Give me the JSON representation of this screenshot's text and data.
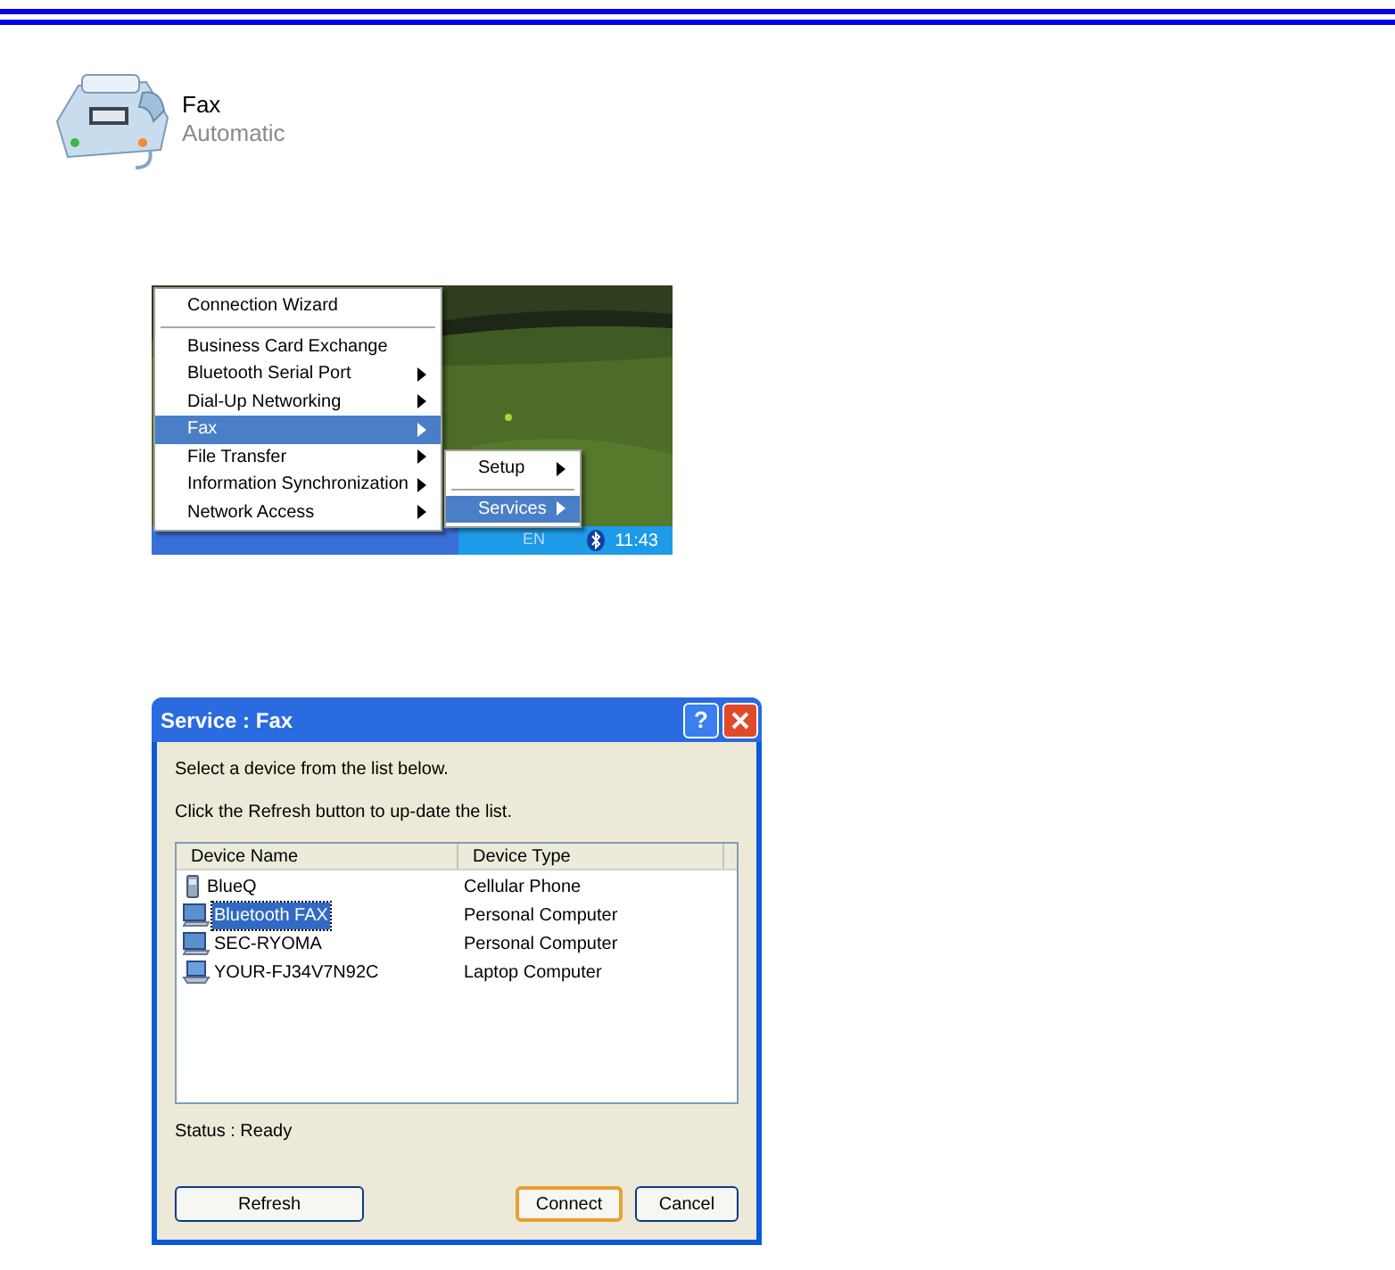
{
  "header": {
    "title": "Fax",
    "subtitle": "Automatic"
  },
  "menu": {
    "items": [
      {
        "kind": "item",
        "label": "Connection Wizard",
        "submenu": false,
        "selected": false
      },
      {
        "kind": "separator"
      },
      {
        "kind": "item",
        "label": "Business Card Exchange",
        "submenu": false,
        "selected": false
      },
      {
        "kind": "item",
        "label": "Bluetooth Serial Port",
        "submenu": true,
        "selected": false
      },
      {
        "kind": "item",
        "label": "Dial-Up Networking",
        "submenu": true,
        "selected": false
      },
      {
        "kind": "item",
        "label": "Fax",
        "submenu": true,
        "selected": true
      },
      {
        "kind": "item",
        "label": "File Transfer",
        "submenu": true,
        "selected": false
      },
      {
        "kind": "item",
        "label": "Information Synchronization",
        "submenu": true,
        "selected": false
      },
      {
        "kind": "item",
        "label": "Network Access",
        "submenu": true,
        "selected": false
      }
    ],
    "submenu": [
      {
        "kind": "item",
        "label": "Setup",
        "submenu": true,
        "selected": false
      },
      {
        "kind": "separator"
      },
      {
        "kind": "item",
        "label": "Services",
        "submenu": true,
        "selected": true
      }
    ],
    "taskbar": {
      "language": "EN",
      "clock": "11:43"
    }
  },
  "dialog": {
    "title": "Service : Fax",
    "help": "?",
    "instructions": [
      "Select a device from the list below.",
      "Click the Refresh button to up-date the list."
    ],
    "columns": [
      "Device Name",
      "Device Type"
    ],
    "rows": [
      {
        "kind": "phone",
        "name": "BlueQ",
        "type": "Cellular Phone",
        "selected": false
      },
      {
        "kind": "computer",
        "name": "Bluetooth FAX",
        "type": "Personal Computer",
        "selected": true
      },
      {
        "kind": "computer",
        "name": "SEC-RYOMA",
        "type": "Personal Computer",
        "selected": false
      },
      {
        "kind": "laptop",
        "name": "YOUR-FJ34V7N92C",
        "type": "Laptop Computer",
        "selected": false
      }
    ],
    "status": "Status : Ready",
    "buttons": [
      {
        "label": "Refresh",
        "default": false
      },
      {
        "label": "Connect",
        "default": true
      },
      {
        "label": "Cancel",
        "default": false
      }
    ]
  }
}
